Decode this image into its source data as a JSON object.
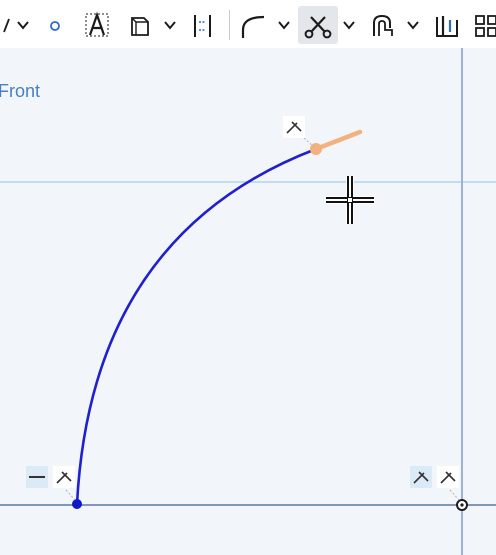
{
  "toolbar": {
    "items": [
      {
        "name": "line-tool",
        "icon": "line-icon"
      },
      {
        "name": "point-tool",
        "icon": "point-icon"
      },
      {
        "name": "text-tool",
        "icon": "text-icon"
      },
      {
        "name": "offset-tool",
        "icon": "offset-icon"
      },
      {
        "name": "mirror-tool",
        "icon": "mirror-icon"
      },
      {
        "name": "fillet-tool",
        "icon": "fillet-icon"
      },
      {
        "name": "trim-tool",
        "icon": "scissors-icon",
        "active": true
      },
      {
        "name": "use-tool",
        "icon": "use-icon"
      },
      {
        "name": "pattern-tool",
        "icon": "pattern-icon"
      },
      {
        "name": "more-tool",
        "icon": "grid-icon"
      }
    ]
  },
  "canvas": {
    "plane_label": "Front",
    "colors": {
      "background": "#f2f6fa",
      "arc": "#2020cc",
      "axis_horizontal": "#7f98b8",
      "axis_vertical": "#9cb4d0",
      "grid_line": "#a9cbea",
      "highlight": "#f3b17e"
    },
    "constraints": [
      {
        "name": "horizontal-constraint-icon",
        "label": "—"
      },
      {
        "name": "tangent-constraint-icon"
      },
      {
        "name": "coincident-constraint-icon"
      }
    ]
  }
}
